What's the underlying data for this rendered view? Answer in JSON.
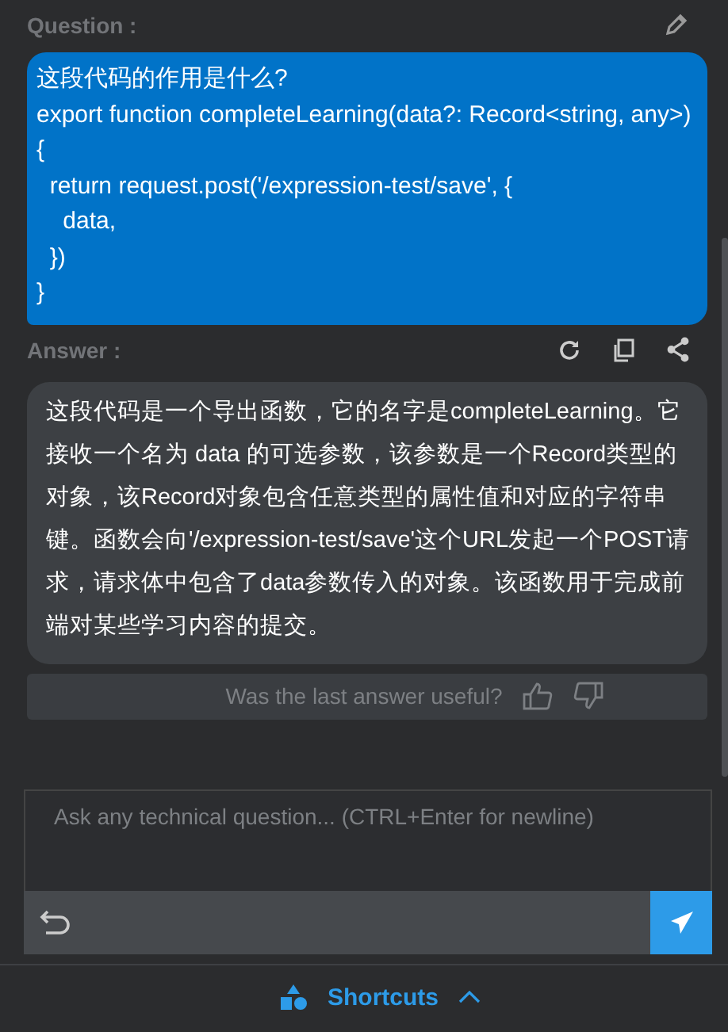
{
  "question": {
    "label": "Question :",
    "text": "这段代码的作用是什么?\nexport function completeLearning(data?: Record<string, any>) {\n  return request.post('/expression-test/save', {\n    data,\n  })\n}"
  },
  "answer": {
    "label": "Answer :",
    "text": "这段代码是一个导出函数，它的名字是completeLearning。它接收一个名为 data 的可选参数，该参数是一个Record类型的对象，该Record对象包含任意类型的属性值和对应的字符串键。函数会向'/expression-test/save'这个URL发起一个POST请求，请求体中包含了data参数传入的对象。该函数用于完成前端对某些学习内容的提交。"
  },
  "feedback": {
    "text": "Was the last answer useful?"
  },
  "input": {
    "placeholder": "Ask any technical question... (CTRL+Enter for newline)"
  },
  "footer": {
    "label": "Shortcuts",
    "expanded": false
  }
}
